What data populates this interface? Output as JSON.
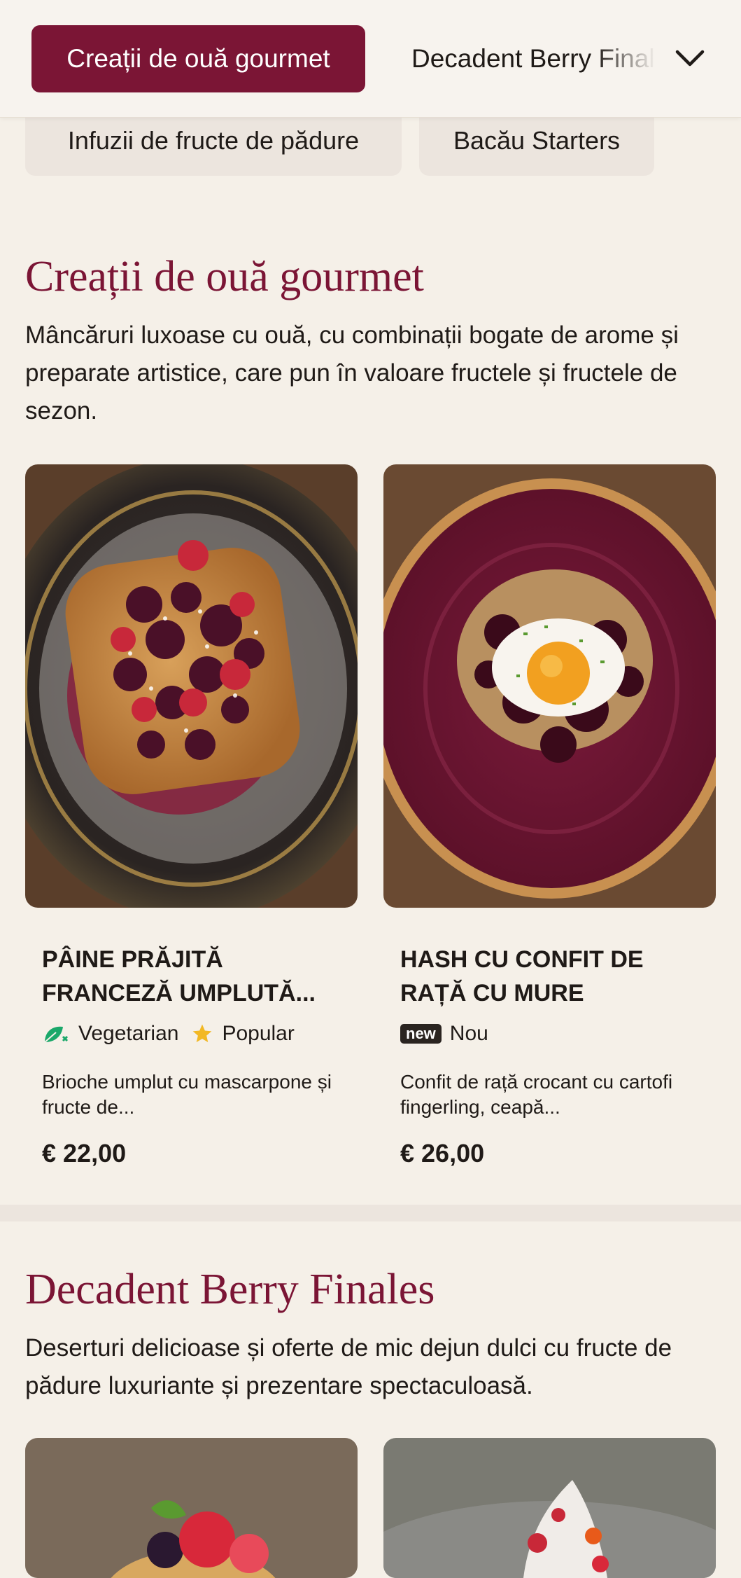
{
  "nav": {
    "active_label": "Creații de ouă gourmet",
    "next_label": "Decadent Berry Finales",
    "chips": [
      "Infuzii de fructe de pădure",
      "Bacău Starters"
    ]
  },
  "sections": [
    {
      "title": "Creații de ouă gourmet",
      "description": "Mâncăruri luxoase cu ouă, cu combinații bogate de arome și preparate artistice, care pun în valoare fructele și fructele de sezon.",
      "items": [
        {
          "name": "PÂINE PRĂJITĂ FRANCEZĂ UMPLUTĂ...",
          "tags": [
            "Vegetarian",
            "Popular"
          ],
          "description": "Brioche umplut cu mascarpone și fructe de...",
          "price": "€ 22,00"
        },
        {
          "name": "HASH CU CONFIT DE RAȚĂ CU MURE",
          "badge": "new",
          "tags": [
            "Nou"
          ],
          "description": "Confit de rață crocant cu cartofi fingerling, ceapă...",
          "price": "€ 26,00"
        }
      ]
    },
    {
      "title": "Decadent Berry Finales",
      "description": "Deserturi delicioase și oferte de mic dejun dulci cu fructe de pădure luxuriante și prezentare spectaculoasă."
    }
  ],
  "colors": {
    "accent": "#7b1535",
    "background": "#f5f0e8",
    "chip": "#ece5de"
  },
  "icons": [
    "chevron-down-icon",
    "vegetarian-leaf-icon",
    "star-icon"
  ]
}
